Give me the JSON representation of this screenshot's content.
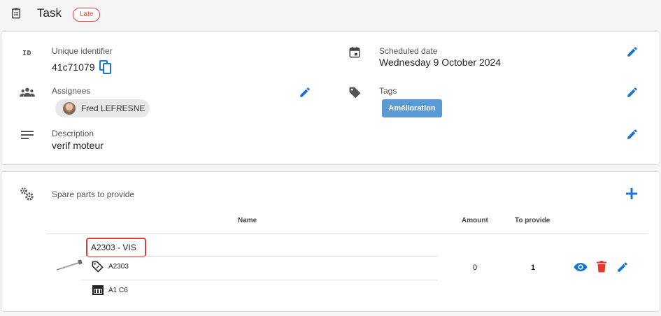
{
  "header": {
    "icon": "clipboard-icon",
    "title": "Task",
    "status_badge": "Late"
  },
  "details": {
    "identifier": {
      "icon": "id-icon",
      "icon_text": "ID",
      "label": "Unique identifier",
      "value": "41c71079"
    },
    "scheduled": {
      "icon": "calendar-icon",
      "label": "Scheduled date",
      "value": "Wednesday 9 October 2024"
    },
    "assignees": {
      "icon": "people-icon",
      "label": "Assignees",
      "items": [
        {
          "name": "Fred LEFRESNE"
        }
      ]
    },
    "tags": {
      "icon": "tag-icon",
      "label": "Tags",
      "items": [
        {
          "label": "Amélioration",
          "color": "#5b9bd5"
        }
      ]
    },
    "description": {
      "icon": "text-lines-icon",
      "label": "Description",
      "value": "verif moteur"
    }
  },
  "spare_parts": {
    "icon": "gears-icon",
    "title": "Spare parts to provide",
    "columns": {
      "name": "Name",
      "amount": "Amount",
      "to_provide": "To provide"
    },
    "rows": [
      {
        "name": "A2303 - VIS",
        "reference": "A2303",
        "location": "A1 C6",
        "amount": "0",
        "to_provide": "1"
      }
    ]
  },
  "colors": {
    "accent": "#1976d2",
    "danger": "#e53935",
    "badge": "#e0413a",
    "tag": "#5b9bd5"
  }
}
